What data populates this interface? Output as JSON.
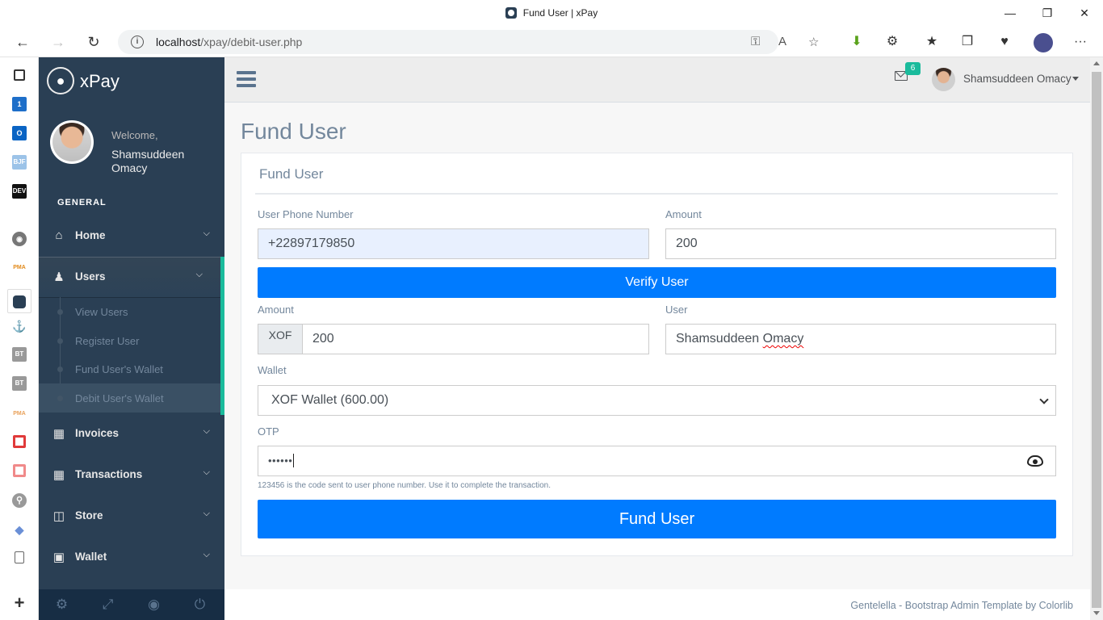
{
  "browser": {
    "tab_title": "Fund User | xPay",
    "url_host": "localhost",
    "url_path": "/xpay/debit-user.php"
  },
  "edge_sidebar": {
    "icons": [
      "tabs-icon",
      "one-icon",
      "outlook-icon",
      "bjf-icon",
      "dev-icon",
      "github-icon",
      "pma-icon",
      "xpay-icon",
      "extension-icon",
      "bt-icon",
      "bt-icon",
      "pma-icon",
      "bookmark-icon",
      "bookmark-icon",
      "search-icon",
      "office-icon",
      "page-icon",
      "page-icon"
    ],
    "labels": {
      "bjf": "BJF",
      "dev": "DEV",
      "bt": "BT",
      "one": "1",
      "pma": "PMA"
    }
  },
  "sidebar": {
    "brand": "xPay",
    "welcome": "Welcome,",
    "user_name": "Shamsuddeen Omacy",
    "section": "GENERAL",
    "menu": [
      {
        "label": "Home",
        "icon": "home-icon"
      },
      {
        "label": "Users",
        "icon": "users-icon"
      },
      {
        "label": "Invoices",
        "icon": "table-icon"
      },
      {
        "label": "Transactions",
        "icon": "table-icon"
      },
      {
        "label": "Store",
        "icon": "building-icon"
      },
      {
        "label": "Wallet",
        "icon": "money-icon"
      }
    ],
    "submenu": [
      "View Users",
      "Register User",
      "Fund User's Wallet",
      "Debit User's Wallet"
    ]
  },
  "topnav": {
    "mail_count": "6",
    "user": "Shamsuddeen Omacy"
  },
  "page": {
    "title": "Fund User",
    "panel_title": "Fund User",
    "phone_label": "User Phone Number",
    "phone_value": "+22897179850",
    "amount_label": "Amount",
    "amount_value": "200",
    "verify_button": "Verify User",
    "amount2_label": "Amount",
    "currency": "XOF",
    "amount2_value": "200",
    "user_label": "User",
    "user_first": "Shamsuddeen",
    "user_last": "Omacy",
    "wallet_label": "Wallet",
    "wallet_value": "XOF Wallet (600.00)",
    "otp_label": "OTP",
    "otp_value": "••••••",
    "otp_help": "123456 is the code sent to user phone number. Use it to complete the transaction.",
    "fund_button": "Fund User"
  },
  "footer": {
    "text": "Gentelella - Bootstrap Admin Template by Colorlib"
  },
  "colors": {
    "sidebar_bg": "#2a3f54",
    "accent_green": "#1abb9c",
    "primary_blue": "#007bff"
  }
}
